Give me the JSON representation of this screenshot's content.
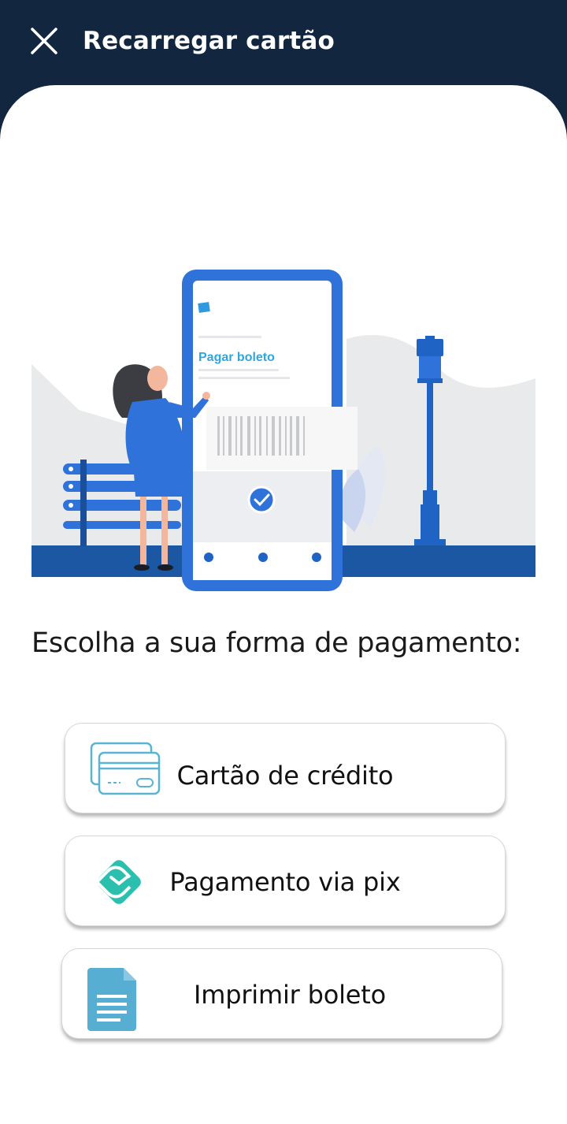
{
  "header": {
    "title": "Recarregar cartão",
    "close_icon": "close-icon"
  },
  "illustration": {
    "screen_title": "Pagar boleto"
  },
  "main": {
    "prompt": "Escolha a sua forma de pagamento:",
    "options": [
      {
        "label": "Cartão de crédito",
        "icon": "credit-card-icon"
      },
      {
        "label": "Pagamento via pix",
        "icon": "pix-icon"
      },
      {
        "label": "Imprimir boleto",
        "icon": "document-icon"
      }
    ]
  },
  "colors": {
    "header_bg": "#12263f",
    "accent_blue": "#2f72d9",
    "pix_teal": "#2bbfae",
    "card_icon": "#58b4d1",
    "doc_icon": "#57aed3"
  }
}
